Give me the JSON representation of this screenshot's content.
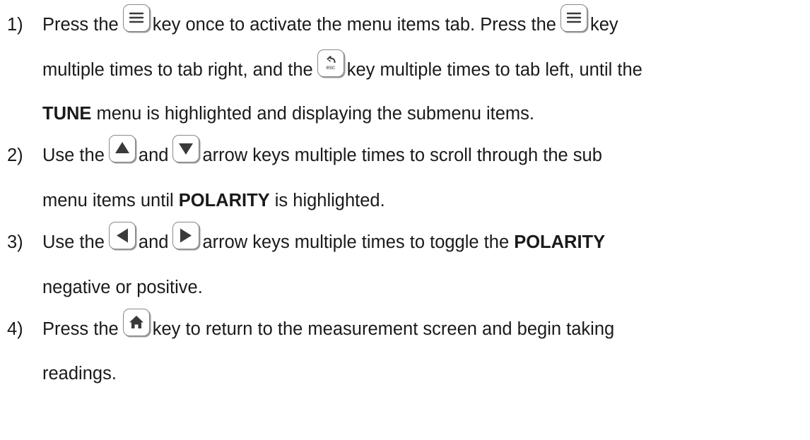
{
  "steps": [
    {
      "number": "1)",
      "lines": [
        {
          "a": "Press the",
          "key1": "menu-key",
          "b": "key once to activate the menu items tab.  Press the",
          "key2": "menu-key",
          "c": "key"
        },
        {
          "a": "multiple times to tab right, and the",
          "key1": "esc-key",
          "b": "key multiple times to tab left, until the"
        },
        {
          "bold": "TUNE",
          "a": " menu is highlighted and displaying the submenu items."
        }
      ]
    },
    {
      "number": "2)",
      "lines": [
        {
          "a": "Use the",
          "key1": "up-arrow-key",
          "b": "and",
          "key2": "down-arrow-key",
          "c": "arrow keys multiple times to scroll through the sub"
        },
        {
          "a": "menu items until ",
          "bold": "POLARITY",
          "b": " is highlighted."
        }
      ]
    },
    {
      "number": "3)",
      "lines": [
        {
          "a": "Use the",
          "key1": "left-arrow-key",
          "b": "and",
          "key2": "right-arrow-key",
          "c": "arrow keys multiple times to toggle the ",
          "bold": "POLARITY"
        },
        {
          "a": "negative or positive."
        }
      ]
    },
    {
      "number": "4)",
      "lines": [
        {
          "a": "Press the",
          "key1": "home-key",
          "b": "key to return to the measurement screen and begin taking"
        },
        {
          "a": "readings."
        }
      ]
    }
  ],
  "esc_key_label": "esc",
  "icon_color": "#3a3a3a"
}
